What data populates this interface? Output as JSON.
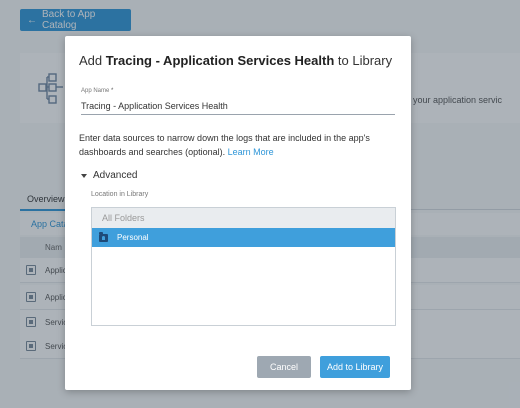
{
  "background": {
    "back_button": "Back to App Catalog",
    "description_fragment": "nto your application servic",
    "tab_overview": "Overview",
    "sub_link": "App Catalo",
    "table_header": "Nam",
    "rows": [
      "Applic",
      "Applic",
      "Servic",
      "Servic"
    ]
  },
  "modal": {
    "title_prefix": "Add ",
    "title_app": "Tracing - Application Services Health",
    "title_suffix": " to Library",
    "app_name_label": "App Name",
    "app_name_required": "*",
    "app_name_value": "Tracing - Application Services Health",
    "help_text": "Enter data sources to narrow down the logs that are included in the app's dashboards and searches (optional).",
    "learn_more": "Learn More",
    "advanced_label": "Advanced",
    "location_label": "Location in Library",
    "folders": {
      "all": "All Folders",
      "selected": "Personal"
    },
    "cancel_button": "Cancel",
    "add_button": "Add to Library"
  },
  "colors": {
    "accent": "#3f9fdc",
    "cancel": "#9ea8b2",
    "folder_icon": "#1e4a78"
  }
}
